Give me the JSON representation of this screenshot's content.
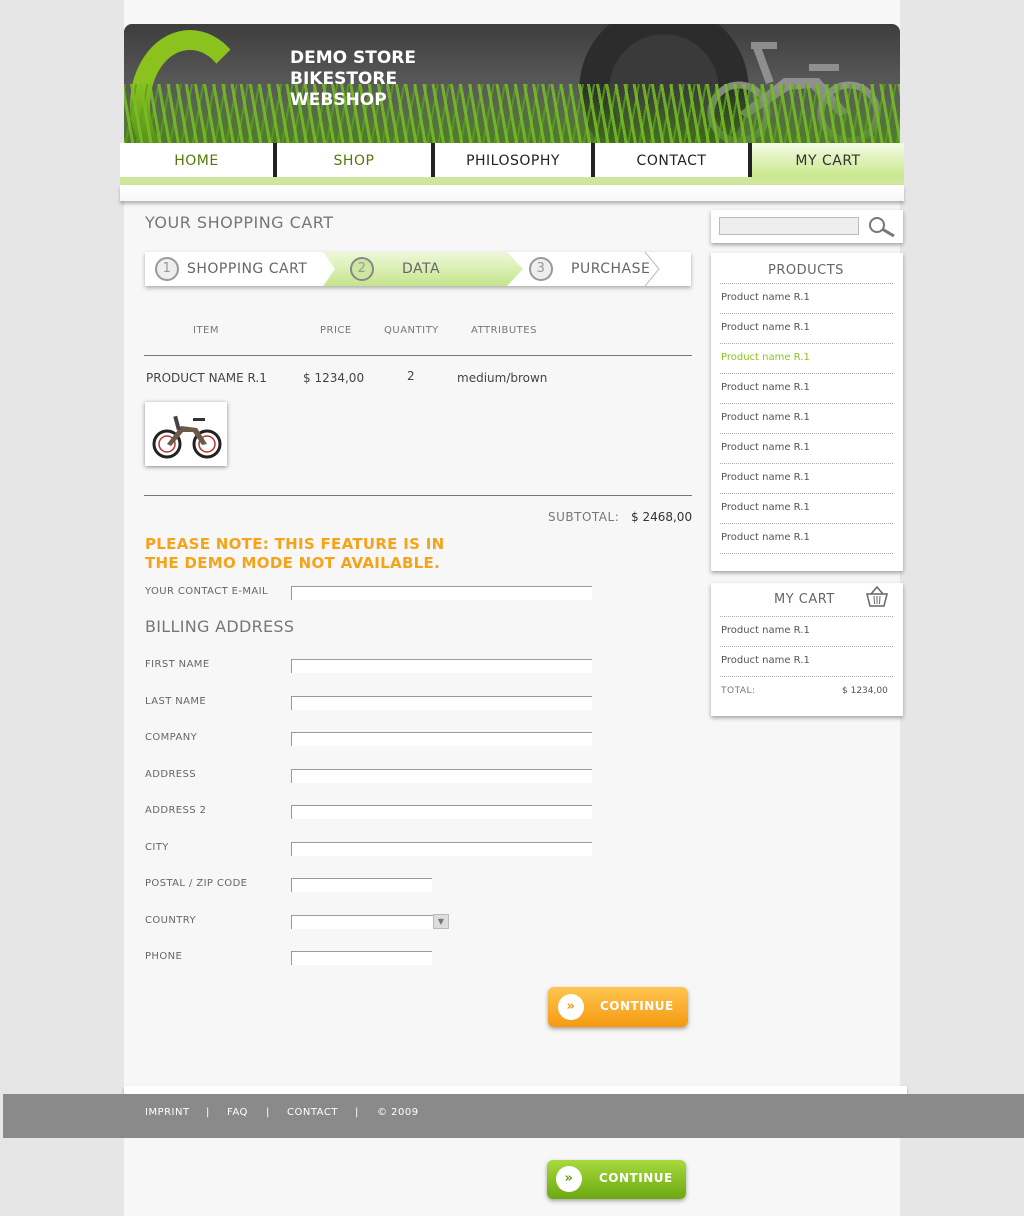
{
  "header": {
    "title_lines": [
      "DEMO STORE",
      "BIKESTORE",
      "WEBSHOP"
    ]
  },
  "nav": {
    "items": [
      "HOME",
      "SHOP",
      "PHILOSOPHY",
      "CONTACT",
      "MY CART"
    ],
    "active": "MY CART"
  },
  "cart": {
    "heading": "YOUR SHOPPING CART",
    "steps": [
      {
        "num": "1",
        "label": "SHOPPING CART"
      },
      {
        "num": "2",
        "label": "DATA"
      },
      {
        "num": "3",
        "label": "PURCHASE"
      }
    ],
    "columns": [
      "ITEM",
      "PRICE",
      "QUANTITY",
      "ATTRIBUTES"
    ],
    "item": {
      "name": "PRODUCT NAME R.1",
      "price": "$ 1234,00",
      "quantity": "2",
      "attributes": "medium/brown"
    },
    "subtotal_label": "SUBTOTAL:",
    "subtotal_value": "$ 2468,00"
  },
  "note": {
    "line1": "PLEASE NOTE: THIS FEATURE IS IN",
    "line2": "THE DEMO MODE NOT AVAILABLE."
  },
  "form": {
    "email_label": "YOUR CONTACT E-MAIL",
    "billing_heading": "BILLING ADDRESS",
    "fields": {
      "first_name": "FIRST NAME",
      "last_name": "LAST NAME",
      "company": "COMPANY",
      "address": "ADDRESS",
      "address2": "ADDRESS 2",
      "city": "CITY",
      "zip": "POSTAL / ZIP CODE",
      "country": "COUNTRY",
      "phone": "PHONE"
    },
    "continue_label": "CONTINUE"
  },
  "sidebar": {
    "search_placeholder": "",
    "products_title": "PRODUCTS",
    "products": [
      "Product name R.1",
      "Product name R.1",
      "Product name R.1",
      "Product name R.1",
      "Product name R.1",
      "Product name R.1",
      "Product name R.1",
      "Product name R.1",
      "Product name R.1"
    ],
    "highlight_color": "#8cc21e",
    "cart_title": "MY CART",
    "cart_items": [
      "Product name R.1",
      "Product name R.1"
    ],
    "total_label": "TOTAL:",
    "total_value": "$ 1234,00"
  },
  "footer": {
    "links": [
      "IMPRINT",
      "FAQ",
      "CONTACT",
      "© 2009"
    ],
    "separator": "|"
  },
  "bottom_button": {
    "label": "CONTINUE"
  },
  "colors": {
    "accent_green": "#8cc21e",
    "note_orange": "#f5a319",
    "footer_gray": "#8a8a8a"
  }
}
